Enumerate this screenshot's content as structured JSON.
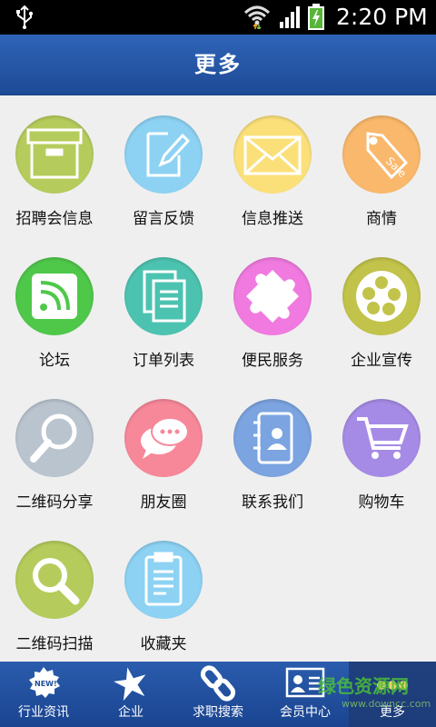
{
  "status_bar": {
    "time": "2:20 PM"
  },
  "header": {
    "title": "更多"
  },
  "grid": {
    "items": [
      {
        "label": "招聘会信息",
        "icon": "box-icon",
        "color": "#b5cc5c"
      },
      {
        "label": "留言反馈",
        "icon": "edit-icon",
        "color": "#8dd2f3"
      },
      {
        "label": "信息推送",
        "icon": "envelope-icon",
        "color": "#fbe07a"
      },
      {
        "label": "商情",
        "icon": "sale-tag-icon",
        "color": "#f9b86b"
      },
      {
        "label": "论坛",
        "icon": "rss-icon",
        "color": "#4fc84a"
      },
      {
        "label": "订单列表",
        "icon": "documents-icon",
        "color": "#4cc3b0"
      },
      {
        "label": "便民服务",
        "icon": "puzzle-icon",
        "color": "#f07adf"
      },
      {
        "label": "企业宣传",
        "icon": "film-reel-icon",
        "color": "#c2c34a"
      },
      {
        "label": "二维码分享",
        "icon": "magnifier-icon",
        "color": "#b9c4cf"
      },
      {
        "label": "朋友圈",
        "icon": "chat-bubbles-icon",
        "color": "#f7889a"
      },
      {
        "label": "联系我们",
        "icon": "contacts-icon",
        "color": "#7ba4e0"
      },
      {
        "label": "购物车",
        "icon": "cart-icon",
        "color": "#a68be6"
      },
      {
        "label": "二维码扫描",
        "icon": "search-icon",
        "color": "#b5cc5c"
      },
      {
        "label": "收藏夹",
        "icon": "clipboard-icon",
        "color": "#8dd2f3"
      }
    ]
  },
  "tabbar": {
    "items": [
      {
        "label": "行业资讯",
        "icon": "news-badge-icon"
      },
      {
        "label": "企业",
        "icon": "star-icon"
      },
      {
        "label": "求职搜索",
        "icon": "link-icon"
      },
      {
        "label": "会员中心",
        "icon": "id-card-icon"
      },
      {
        "label": "更多",
        "icon": "more-dots-icon"
      }
    ],
    "active_index": 4
  },
  "watermark": {
    "line1": "绿色资源网",
    "line2": "www.downcc.com"
  }
}
